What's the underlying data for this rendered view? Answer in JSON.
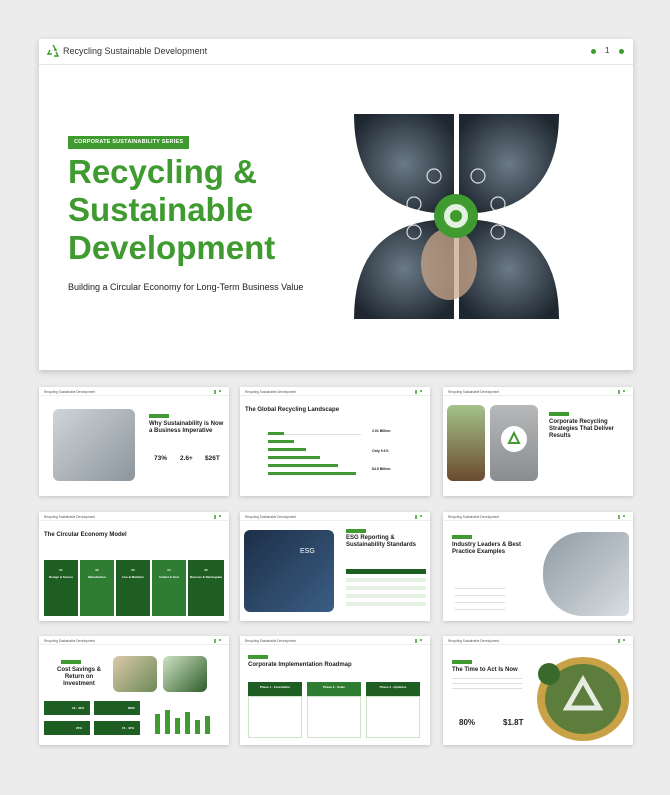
{
  "hero": {
    "header_title": "Recycling Sustainable Development",
    "page_number": "1",
    "badge": "CORPORATE SUSTAINABILITY SERIES",
    "title_line1": "Recycling &",
    "title_line2": "Sustainable",
    "title_line3": "Development",
    "subtitle": "Building a Circular Economy for Long-Term Business Value"
  },
  "thumbs": {
    "header": "Recycling Sustainable Development",
    "s2": {
      "title1": "Why Sustainability is Now",
      "title2": "a Business Imperative",
      "stats": [
        "73%",
        "2.6+",
        "$26T"
      ]
    },
    "s3": {
      "title": "The Global Recycling Landscape",
      "stats": [
        "2.01 Billion",
        "Only 9.1%",
        "$4.5 Billion"
      ]
    },
    "s4": {
      "title1": "Corporate Recycling",
      "title2": "Strategies That Deliver",
      "title3": "Results"
    },
    "s5": {
      "title": "The Circular Economy Model",
      "steps": [
        {
          "num": "01",
          "label": "Design & Source"
        },
        {
          "num": "02",
          "label": "Manufacture"
        },
        {
          "num": "03",
          "label": "Use & Maintain"
        },
        {
          "num": "04",
          "label": "Collect & Sort"
        },
        {
          "num": "05",
          "label": "Recover & Reintegrate"
        }
      ]
    },
    "s6": {
      "title1": "ESG Reporting &",
      "title2": "Sustainability Standards",
      "photo_text": "ESG"
    },
    "s7": {
      "title1": "Industry Leaders & Best",
      "title2": "Practice Examples"
    },
    "s8": {
      "title1": "Cost Savings &",
      "title2": "Return on",
      "title3": "Investment",
      "kpis": [
        "18 - 40%",
        "$300",
        "25%",
        "15 - 40%"
      ]
    },
    "s9": {
      "title": "Corporate Implementation Roadmap",
      "phases": [
        "Phase 1 - Foundation",
        "Phase 2 - Scale",
        "Phase 3 - Optimize"
      ]
    },
    "s10": {
      "title": "The Time to Act Is Now",
      "stats": [
        "80%",
        "$1.8T"
      ]
    }
  },
  "colors": {
    "accent": "#3f9b2f",
    "dark_green": "#1f5e22"
  }
}
